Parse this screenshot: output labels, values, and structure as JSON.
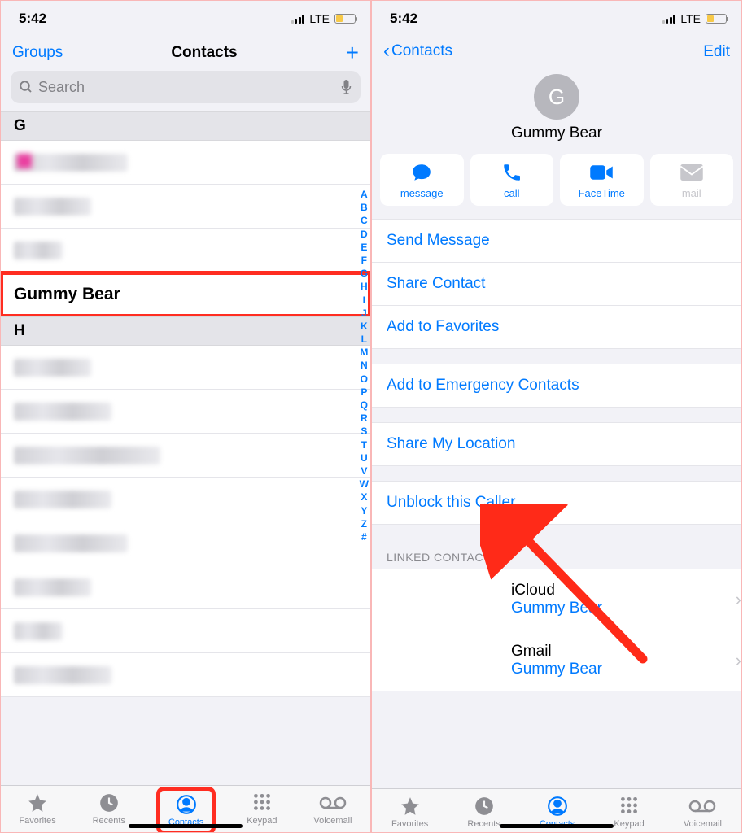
{
  "status": {
    "time": "5:42",
    "network": "LTE"
  },
  "left": {
    "nav": {
      "groups": "Groups",
      "title": "Contacts"
    },
    "search_placeholder": "Search",
    "sections": {
      "g": "G",
      "h": "H",
      "highlighted_contact": "Gummy Bear"
    },
    "index": [
      "A",
      "B",
      "C",
      "D",
      "E",
      "F",
      "G",
      "H",
      "I",
      "J",
      "K",
      "L",
      "M",
      "N",
      "O",
      "P",
      "Q",
      "R",
      "S",
      "T",
      "U",
      "V",
      "W",
      "X",
      "Y",
      "Z",
      "#"
    ]
  },
  "right": {
    "nav": {
      "back": "Contacts",
      "edit": "Edit"
    },
    "contact": {
      "initial": "G",
      "name": "Gummy Bear"
    },
    "actions": {
      "message": "message",
      "call": "call",
      "facetime": "FaceTime",
      "mail": "mail"
    },
    "rows": {
      "send_message": "Send Message",
      "share_contact": "Share Contact",
      "add_favorites": "Add to Favorites",
      "emergency": "Add to Emergency Contacts",
      "share_location": "Share My Location",
      "unblock": "Unblock this Caller",
      "linked_header": "LINKED CONTACTS",
      "linked": [
        {
          "source": "iCloud",
          "name": "Gummy Bear"
        },
        {
          "source": "Gmail",
          "name": "Gummy Bear"
        }
      ]
    }
  },
  "tabs": {
    "favorites": "Favorites",
    "recents": "Recents",
    "contacts": "Contacts",
    "keypad": "Keypad",
    "voicemail": "Voicemail"
  }
}
